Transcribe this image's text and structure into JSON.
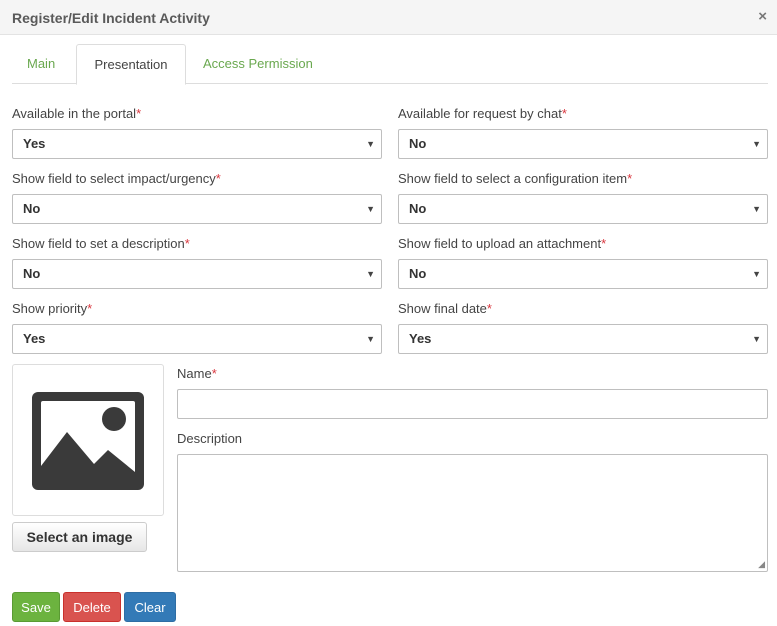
{
  "header": {
    "title": "Register/Edit Incident Activity",
    "close_label": "×"
  },
  "tabs": [
    {
      "label": "Main",
      "active": false
    },
    {
      "label": "Presentation",
      "active": true
    },
    {
      "label": "Access Permission",
      "active": false
    }
  ],
  "fields": {
    "portal": {
      "label": "Available in the portal",
      "required": "*",
      "value": "Yes"
    },
    "chat": {
      "label": "Available for request by chat",
      "required": "*",
      "value": "No"
    },
    "impact": {
      "label": "Show field to select impact/urgency",
      "required": "*",
      "value": "No"
    },
    "config_item": {
      "label": "Show field to select a configuration item",
      "required": "*",
      "value": "No"
    },
    "description": {
      "label": "Show field to set a description",
      "required": "*",
      "value": "No"
    },
    "attachment": {
      "label": "Show field to upload an attachment",
      "required": "*",
      "value": "No"
    },
    "priority": {
      "label": "Show priority",
      "required": "*",
      "value": "Yes"
    },
    "final_date": {
      "label": "Show final date",
      "required": "*",
      "value": "Yes"
    }
  },
  "image_panel": {
    "icon": "image-placeholder-icon",
    "button_label": "Select an image"
  },
  "name_field": {
    "label": "Name",
    "required": "*",
    "value": ""
  },
  "description_field": {
    "label": "Description",
    "value": ""
  },
  "caret": "▼",
  "buttons": {
    "save": "Save",
    "delete": "Delete",
    "clear": "Clear"
  },
  "colors": {
    "tab_link": "#6aa84f",
    "required": "#d9363e",
    "save": "#6cb33f",
    "delete": "#d9534f",
    "clear": "#337ab7"
  }
}
